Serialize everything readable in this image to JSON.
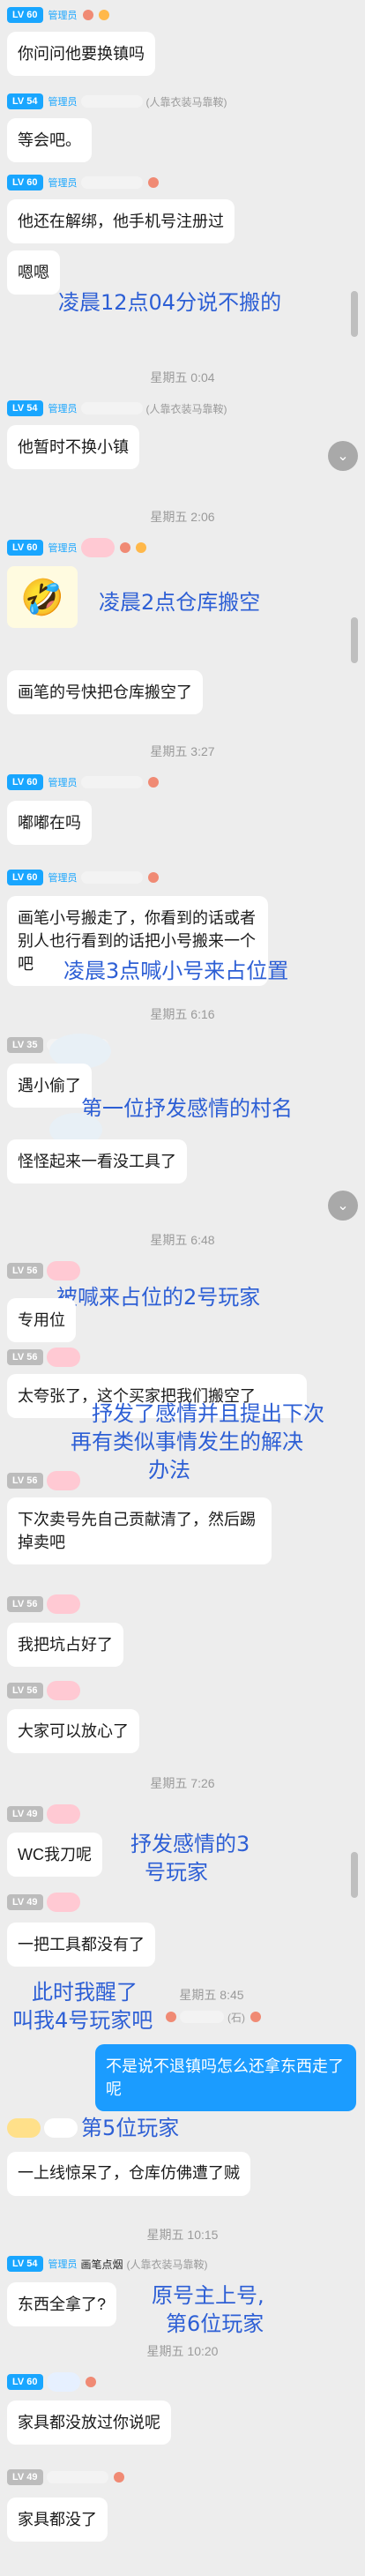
{
  "badges": {
    "lv60": "LV 60",
    "lv54": "LV 54",
    "lv35": "LV 35",
    "lv56": "LV 56",
    "lv49": "LV 49",
    "admin": "管理员"
  },
  "tags": {
    "group_tag": "(人靠衣装马靠鞍)",
    "stone": "(石)",
    "painting": "画笔点烟",
    "painting_group": "(人靠衣装马靠鞍)"
  },
  "messages": {
    "m1": "你问问他要换镇吗",
    "m2": "等会吧。",
    "m3": "他还在解绑，他手机号注册过",
    "m4": "嗯嗯",
    "m5": "他暂时不换小镇",
    "m6": "画笔的号快把仓库搬空了",
    "m7": "嘟嘟在吗",
    "m8": "画笔小号搬走了，你看到的话或者别人也行看到的话把小号搬来一个吧",
    "m9": "遇小偷了",
    "m10": "怪怪起来一看没工具了",
    "m11": "专用位",
    "m12": "太夸张了，这个买家把我们搬空了",
    "m13": "下次卖号先自己贡献清了，然后踢掉卖吧",
    "m14": "我把坑占好了",
    "m15": "大家可以放心了",
    "m16": "WC我刀呢",
    "m17": "一把工具都没有了",
    "m18": "不是说不退镇吗怎么还拿东西走了呢",
    "m19": "一上线惊呆了，仓库仿佛遭了贼",
    "m20": "东西全拿了?",
    "m21": "家具都没放过你说呢",
    "m22": "家具都没了"
  },
  "times": {
    "t1": "星期五 0:04",
    "t2": "星期五 2:06",
    "t3": "星期五 3:27",
    "t4": "星期五 6:16",
    "t5": "星期五 6:48",
    "t6": "星期五 7:26",
    "t7": "星期五 8:45",
    "t8": "星期五 10:15",
    "t9": "星期五 10:20"
  },
  "annotations": {
    "a1": "凌晨12点04分说不搬的",
    "a2": "凌晨2点仓库搬空",
    "a3": "凌晨3点喊小号来占位置",
    "a4": "第一位抒发感情的村名",
    "a5": "被喊来占位的2号玩家",
    "a6_l1": "抒发了感情并且提出下次",
    "a6_l2": "再有类似事情发生的解决",
    "a6_l3": "办法",
    "a7_l1": "抒发感情的3",
    "a7_l2": "号玩家",
    "a8_l1": "此时我醒了",
    "a8_l2": "叫我4号玩家吧",
    "a9": "第5位玩家",
    "a10_l1": "原号主上号,",
    "a10_l2": "第6位玩家"
  }
}
